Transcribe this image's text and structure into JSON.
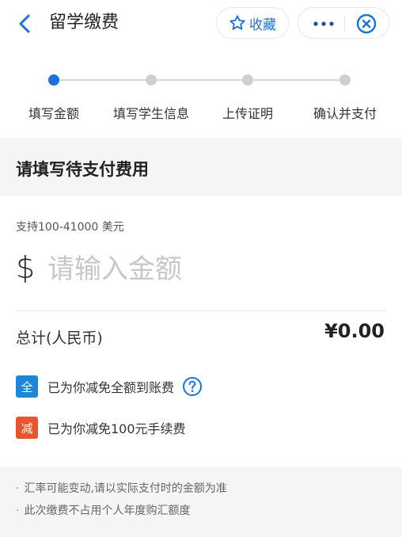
{
  "header": {
    "title": "留学缴费",
    "favorite_label": "收藏"
  },
  "steps": [
    {
      "label": "填写金额",
      "active": true
    },
    {
      "label": "填写学生信息",
      "active": false
    },
    {
      "label": "上传证明",
      "active": false
    },
    {
      "label": "确认并支付",
      "active": false
    }
  ],
  "section": {
    "title": "请填写待支付费用"
  },
  "amount": {
    "support_text": "支持100-41000 美元",
    "currency_symbol": "$",
    "placeholder": "请输入金额",
    "value": ""
  },
  "total": {
    "label": "总计(人民币)",
    "value": "¥0.00"
  },
  "benefits": [
    {
      "badge": "全",
      "badge_color": "#1e88d8",
      "text": "已为你减免全额到账费",
      "help": true
    },
    {
      "badge": "减",
      "badge_color": "#e8542c",
      "text": "已为你减免100元手续费",
      "help": false
    }
  ],
  "notes": [
    "汇率可能变动,请以实际支付时的金额为准",
    "此次缴费不占用个人年度购汇额度"
  ],
  "colors": {
    "accent": "#1a73d9",
    "section_bg": "#f5f5f5"
  },
  "icons": {
    "back": "chevron-left-icon",
    "favorite": "star-icon",
    "more": "more-dots-icon",
    "close": "close-circle-icon",
    "help": "question-circle-icon"
  }
}
